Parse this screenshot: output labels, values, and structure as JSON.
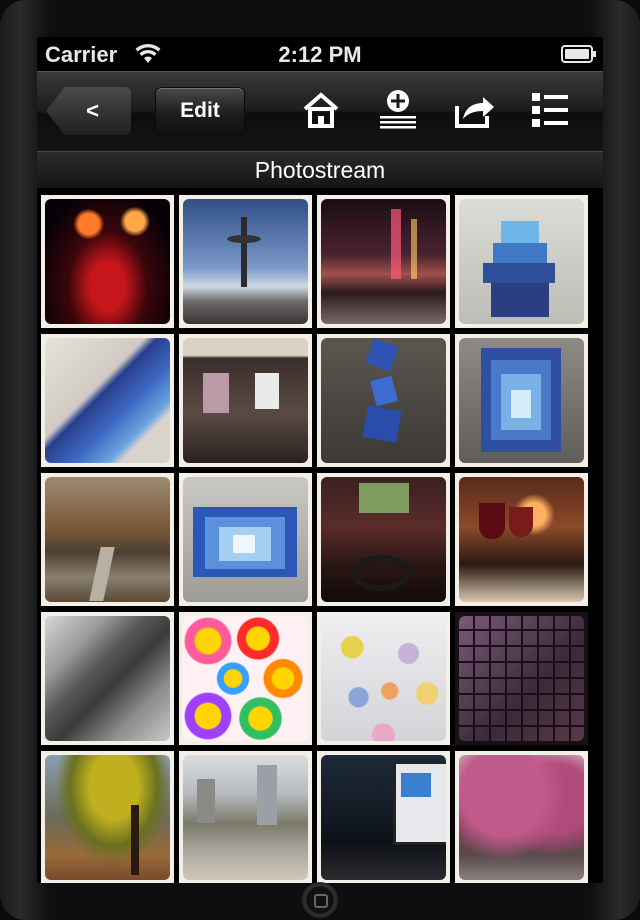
{
  "status_bar": {
    "carrier": "Carrier",
    "time": "2:12 PM"
  },
  "toolbar": {
    "back_label": "<",
    "edit_label": "Edit",
    "icons": [
      "home-icon",
      "add-icon",
      "share-icon",
      "list-icon"
    ]
  },
  "title": "Photostream",
  "colors": {
    "tile_border": "#f3efe6",
    "background": "#000000",
    "title_text": "#ffffff"
  },
  "photos": [
    {
      "row": 0,
      "col": 0,
      "subject": "night stage with red lanterns"
    },
    {
      "row": 0,
      "col": 1,
      "subject": "space needle at dusk"
    },
    {
      "row": 0,
      "col": 2,
      "subject": "city street at night"
    },
    {
      "row": 0,
      "col": 3,
      "subject": "blue layered sculpture on white"
    },
    {
      "row": 1,
      "col": 0,
      "subject": "blue stepped sculpture close-up"
    },
    {
      "row": 1,
      "col": 1,
      "subject": "clothing store window"
    },
    {
      "row": 1,
      "col": 2,
      "subject": "twisting blue tower sculpture"
    },
    {
      "row": 1,
      "col": 3,
      "subject": "concentric blue sculpture"
    },
    {
      "row": 2,
      "col": 0,
      "subject": "autumn path with trees"
    },
    {
      "row": 2,
      "col": 1,
      "subject": "blue nested box sculpture"
    },
    {
      "row": 2,
      "col": 2,
      "subject": "headphones on table"
    },
    {
      "row": 2,
      "col": 3,
      "subject": "wine glasses at dinner"
    },
    {
      "row": 3,
      "col": 0,
      "subject": "curved grey architecture"
    },
    {
      "row": 3,
      "col": 1,
      "subject": "colorful smiling flowers art"
    },
    {
      "row": 3,
      "col": 2,
      "subject": "colored dots on wall"
    },
    {
      "row": 3,
      "col": 3,
      "subject": "purple tiled wall"
    },
    {
      "row": 4,
      "col": 0,
      "subject": "autumn tree and building"
    },
    {
      "row": 4,
      "col": 1,
      "subject": "city plaza with fountain"
    },
    {
      "row": 4,
      "col": 2,
      "subject": "monitor on desk"
    },
    {
      "row": 4,
      "col": 3,
      "subject": "cherry blossom street"
    }
  ]
}
